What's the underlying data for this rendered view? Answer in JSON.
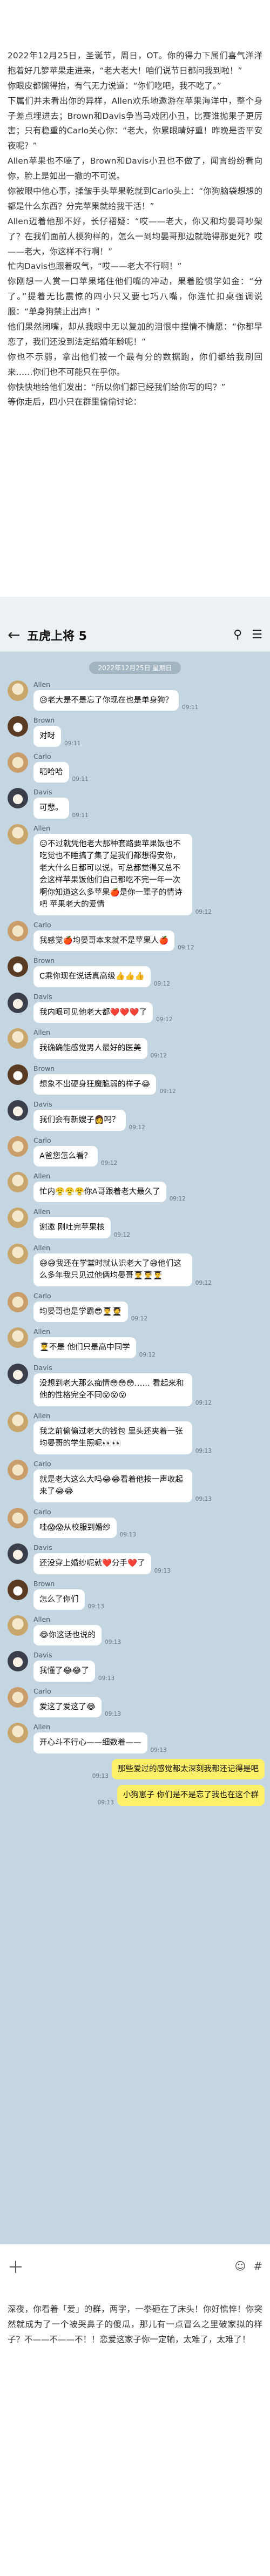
{
  "story_top": [
    "2022年12月25日，圣诞节，周日，OT。你的得力下属们喜气洋洋抱着好几箩苹果走进来，“老大老大！咱们说节日都问我到啦！”",
    "你眼皮都懒得抬，有气无力说道：“你们吃吧，我不吃了。”",
    "下属们并未看出你的异样，Allen欢乐地邀游在苹果海洋中，整个身子差点埋进去；Brown和Davis争当马戏团小丑，比赛谁抛果子更厉害；只有稳重的Carlo关心你：“老大，你累眼睛好重！昨晚是否平安夜呢？”",
    "Allen苹果也不嗑了，Brown和Davis小丑也不做了，闻言纷纷看向你，脸上是如出一撤的不可说。",
    "你被眼中他心事，揉皱手头苹果乾就到Carlo头上：“你狗脑袋想想的都是什么东西？分完苹果就给我干活！”",
    "Allen迈着他那不好，长仔褶疑：“哎——老大，你又和均晏哥吵架了？在我们面前人模狗样的，怎么一到均晏哥那边就跪得那更死？哎——老大，你这样不行啊！”",
    "忙内Davis也跟着叹气，“哎——老大不行啊！”",
    "你刚想一人赏一口苹果堵住他们嘴的冲动，果着脸惯学如金：“分了。”提着无比震惊的四小只又要七巧八嘴，你连忙扣桌强调说服：“单身狗禁止出声！”",
    "他们果然闭嘴，却从我眼中无以复加的泪恨中捏情不情愿：“你都早恋了，我们还没到法定结婚年龄呢！”",
    "你也不示弱，拿出他们被一个最有分的数据跑，你们都给我刷回来……你们也不可能只在乎你。",
    "你快快地给他们发出：“所以你们都已经我们给你写的吗？”",
    "等你走后，四小只在群里偷偷讨论："
  ],
  "chat": {
    "title": "五虎上将 5",
    "back_icon": "back-arrow-icon",
    "date": "2022年12月25日 星期日",
    "messages": [
      {
        "sender": "Allen",
        "avatar": "allen",
        "text": "😥老大是不是忘了你现在也是单身狗？",
        "time": "09:11"
      },
      {
        "sender": "Brown",
        "avatar": "brown",
        "text": "对呀",
        "time": "09:11"
      },
      {
        "sender": "Carlo",
        "avatar": "carlo",
        "text": "呃哈哈",
        "time": "09:11"
      },
      {
        "sender": "Davis",
        "avatar": "davis",
        "text": "可悲。",
        "time": "09:11"
      },
      {
        "sender": "Allen",
        "avatar": "allen",
        "text": "😑不过就凭他老大那种套路要苹果饭也不吃觉也不睡搞了集了是我们都想得安你，老大什么日都可以说，可总都觉得又总不会这样苹果饭他们自己都吃不完一年一次啊你知道这么多苹果🍎是你一辈子的情诗吧 苹果老大的爱情",
        "time": "09:12"
      },
      {
        "sender": "Carlo",
        "avatar": "carlo",
        "text": "我感觉🍎均晏哥本来就不是苹果人🍎",
        "time": "09:12"
      },
      {
        "sender": "Brown",
        "avatar": "brown",
        "text": "C乘你现在说话真高级👍👍👍",
        "time": "09:12"
      },
      {
        "sender": "Davis",
        "avatar": "davis",
        "text": "我内眼可见他老大都❤️❤️❤️了",
        "time": "09:12"
      },
      {
        "sender": "Allen",
        "avatar": "allen",
        "text": "我确确能感觉男人最好的医美",
        "time": "09:12"
      },
      {
        "sender": "Brown",
        "avatar": "brown",
        "text": "想象不出硬身狂魔脆弱的样子😂",
        "time": "09:12"
      },
      {
        "sender": "Davis",
        "avatar": "davis",
        "text": "我们会有新嫂子👩吗？",
        "time": "09:12"
      },
      {
        "sender": "Carlo",
        "avatar": "carlo",
        "text": "A爸您怎么看？",
        "time": "09:12"
      },
      {
        "sender": "Allen",
        "avatar": "allen",
        "text": "忙内😤😤😤你A哥跟着老大最久了",
        "time": "09:12"
      },
      {
        "sender": "Allen",
        "avatar": "allen",
        "text": "谢邀 刚吐完苹果核",
        "time": "09:12"
      },
      {
        "sender": "Allen",
        "avatar": "allen",
        "text": "😅😅我还在学堂时就认识老大了😅他们这么多年我只见过他俩均晏哥👨‍🎓👨‍🎓👨‍🎓",
        "time": "09:12"
      },
      {
        "sender": "Carlo",
        "avatar": "carlo",
        "text": "均晏哥也是学霸😎👨‍🎓🧑‍🎓",
        "time": "09:12"
      },
      {
        "sender": "Allen",
        "avatar": "allen",
        "text": "👨‍🎓不是 他们只是高中同学",
        "time": "09:12"
      },
      {
        "sender": "Davis",
        "avatar": "davis",
        "text": "没想到老大那么痴情😳😳😳…… 看起来和他的性格完全不同😵😵😵",
        "time": "09:12"
      },
      {
        "sender": "Allen",
        "avatar": "allen",
        "text": "我之前偷偷过老大的钱包 里头还夹着一张均晏哥的学生照呢👀👀",
        "time": "09:13"
      },
      {
        "sender": "Carlo",
        "avatar": "carlo",
        "text": "就是老大这么大吗😂😂看着他按一声收起来了😂😂",
        "time": "09:13"
      },
      {
        "sender": "Carlo",
        "avatar": "carlo",
        "text": "哇😱😱从校服到婚纱",
        "time": "09:13"
      },
      {
        "sender": "Davis",
        "avatar": "davis",
        "text": "还没穿上婚纱呢就❤️分手❤️了",
        "time": "09:13"
      },
      {
        "sender": "Brown",
        "avatar": "brown",
        "text": "怎么了你们",
        "time": "09:13"
      },
      {
        "sender": "Allen",
        "avatar": "allen",
        "text": "😂你这话也说的",
        "time": "09:13"
      },
      {
        "sender": "Davis",
        "avatar": "davis",
        "text": "我懂了😂😂了",
        "time": "09:13"
      },
      {
        "sender": "Carlo",
        "avatar": "carlo",
        "text": "爱这了爱这了😂",
        "time": "09:13"
      },
      {
        "sender": "Allen",
        "avatar": "allen",
        "text": "开心斗不行心——细数着——",
        "time": "09:13"
      },
      {
        "sender": "me",
        "avatar": "bubbles",
        "text": "那些爱过的感觉都太深刻我都还记得是吧",
        "time": "09:13"
      },
      {
        "sender": "me",
        "avatar": "bubbles",
        "text": "小狗崽子 你们是不是忘了我也在这个群",
        "time": "09:13"
      }
    ]
  },
  "input": {
    "plus_icon": "plus-icon",
    "emoji_icon": "emoji-icon",
    "hash_icon": "hash-icon"
  },
  "story_bottom": [
    "深夜，你看着「爱」的群，两字，一拳砸在了床头！你好憔悴！你突然就成为了一个被哭鼻子的傻瓜，那儿有一点冒么之里破家拟的样子？不——不——不！！恋爱这家子你一定输，太难了，太难了！"
  ]
}
